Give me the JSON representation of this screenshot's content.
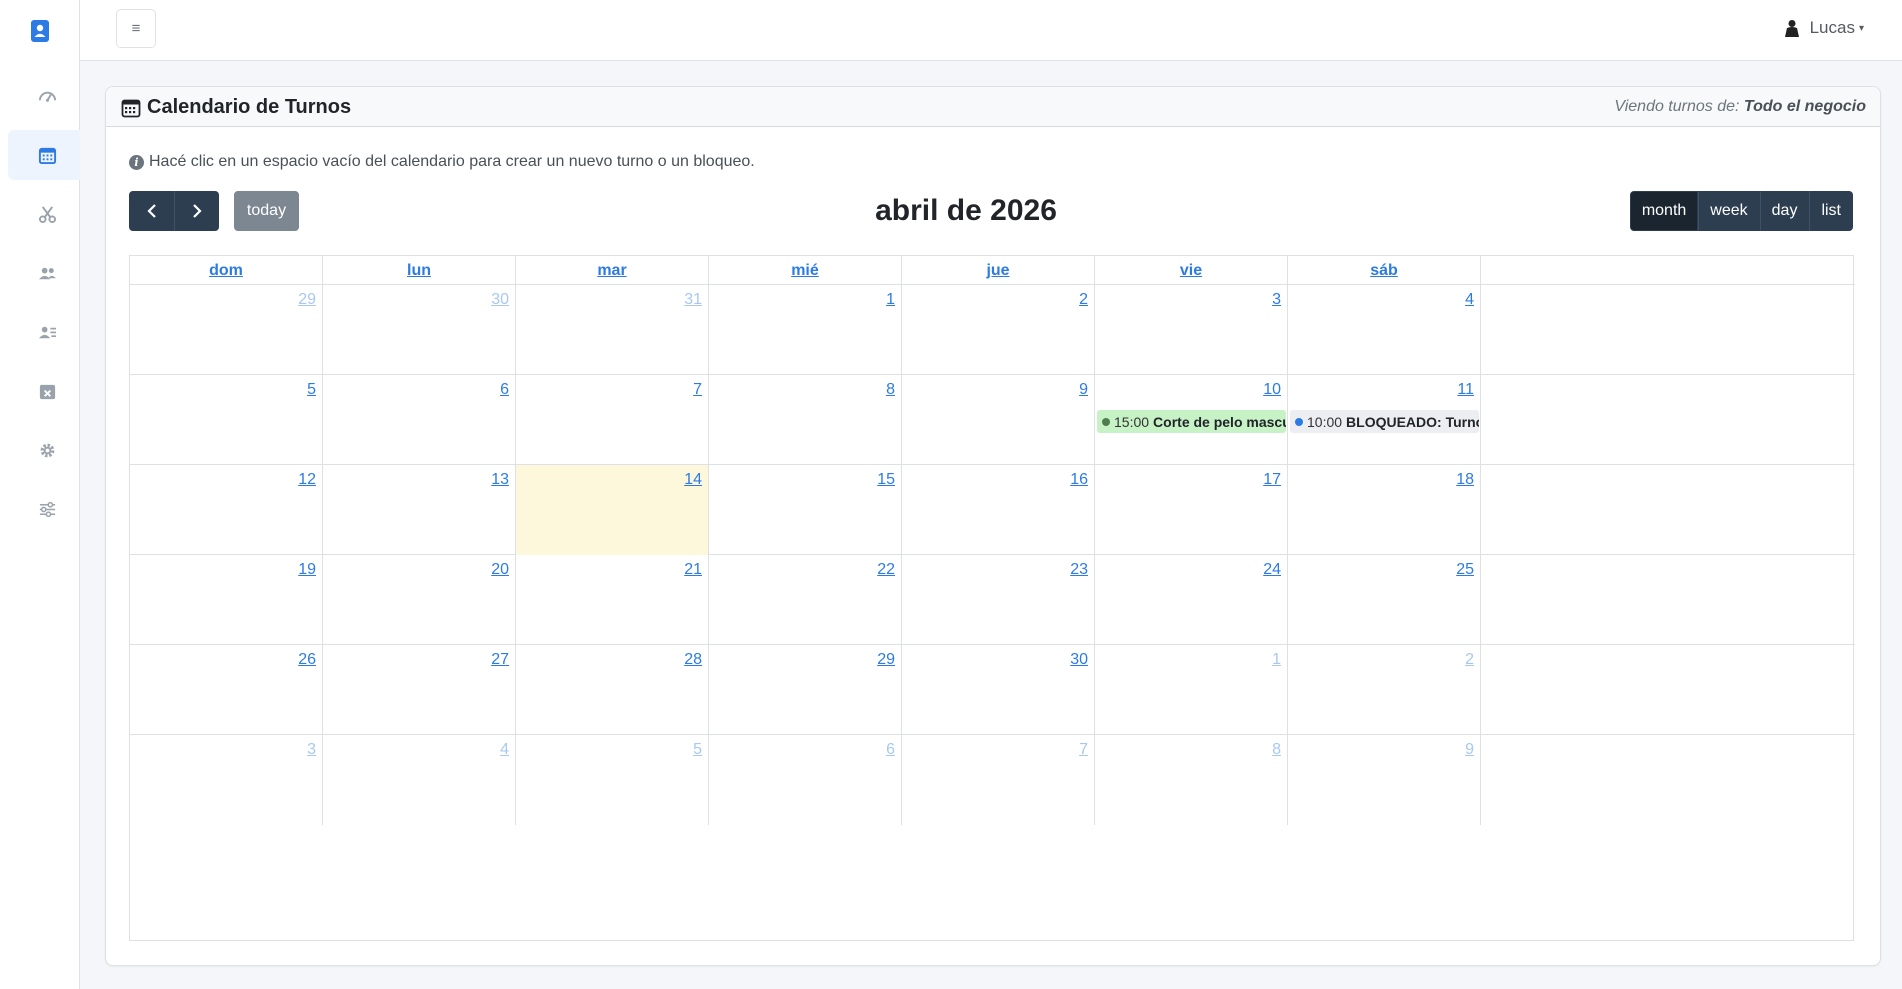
{
  "sidebar": {
    "items": [
      {
        "icon": "dashboard-icon"
      },
      {
        "icon": "calendar-icon",
        "active": true
      },
      {
        "icon": "scissors-icon"
      },
      {
        "icon": "users-icon"
      },
      {
        "icon": "staff-icon"
      },
      {
        "icon": "calendar-x-icon"
      },
      {
        "icon": "gear-icon"
      },
      {
        "icon": "sliders-icon"
      }
    ]
  },
  "topbar": {
    "toggle_label": "≡",
    "user_name": "Lucas"
  },
  "card": {
    "title": "Calendario de Turnos",
    "viewing_prefix": "Viendo turnos de:",
    "viewing_value": "Todo el negocio",
    "hint": "Hacé clic en un espacio vacío del calendario para crear un nuevo turno o un bloqueo."
  },
  "calendar": {
    "title": "abril de 2026",
    "today_label": "today",
    "prev_label": "‹",
    "next_label": "›",
    "views": [
      "month",
      "week",
      "day",
      "list"
    ],
    "active_view": "month",
    "day_headers": [
      "dom",
      "lun",
      "mar",
      "mié",
      "jue",
      "vie",
      "sáb"
    ],
    "today_date": "14",
    "weeks": [
      [
        {
          "n": "29",
          "other": true
        },
        {
          "n": "30",
          "other": true
        },
        {
          "n": "31",
          "other": true
        },
        {
          "n": "1"
        },
        {
          "n": "2"
        },
        {
          "n": "3"
        },
        {
          "n": "4"
        }
      ],
      [
        {
          "n": "5"
        },
        {
          "n": "6"
        },
        {
          "n": "7"
        },
        {
          "n": "8"
        },
        {
          "n": "9"
        },
        {
          "n": "10"
        },
        {
          "n": "11"
        }
      ],
      [
        {
          "n": "12"
        },
        {
          "n": "13"
        },
        {
          "n": "14",
          "today": true
        },
        {
          "n": "15"
        },
        {
          "n": "16"
        },
        {
          "n": "17"
        },
        {
          "n": "18"
        }
      ],
      [
        {
          "n": "19"
        },
        {
          "n": "20"
        },
        {
          "n": "21"
        },
        {
          "n": "22"
        },
        {
          "n": "23"
        },
        {
          "n": "24"
        },
        {
          "n": "25"
        }
      ],
      [
        {
          "n": "26"
        },
        {
          "n": "27"
        },
        {
          "n": "28"
        },
        {
          "n": "29"
        },
        {
          "n": "30"
        },
        {
          "n": "1",
          "other": true
        },
        {
          "n": "2",
          "other": true
        }
      ],
      [
        {
          "n": "3",
          "other": true
        },
        {
          "n": "4",
          "other": true
        },
        {
          "n": "5",
          "other": true
        },
        {
          "n": "6",
          "other": true
        },
        {
          "n": "7",
          "other": true
        },
        {
          "n": "8",
          "other": true
        },
        {
          "n": "9",
          "other": true
        }
      ]
    ],
    "events": [
      {
        "week": 1,
        "day": 5,
        "time": "15:00",
        "title": "Corte de pelo masculino - ",
        "color": "green"
      },
      {
        "week": 1,
        "day": 6,
        "time": "10:00",
        "title": "BLOQUEADO: Turno medic",
        "color": "gray"
      }
    ]
  }
}
